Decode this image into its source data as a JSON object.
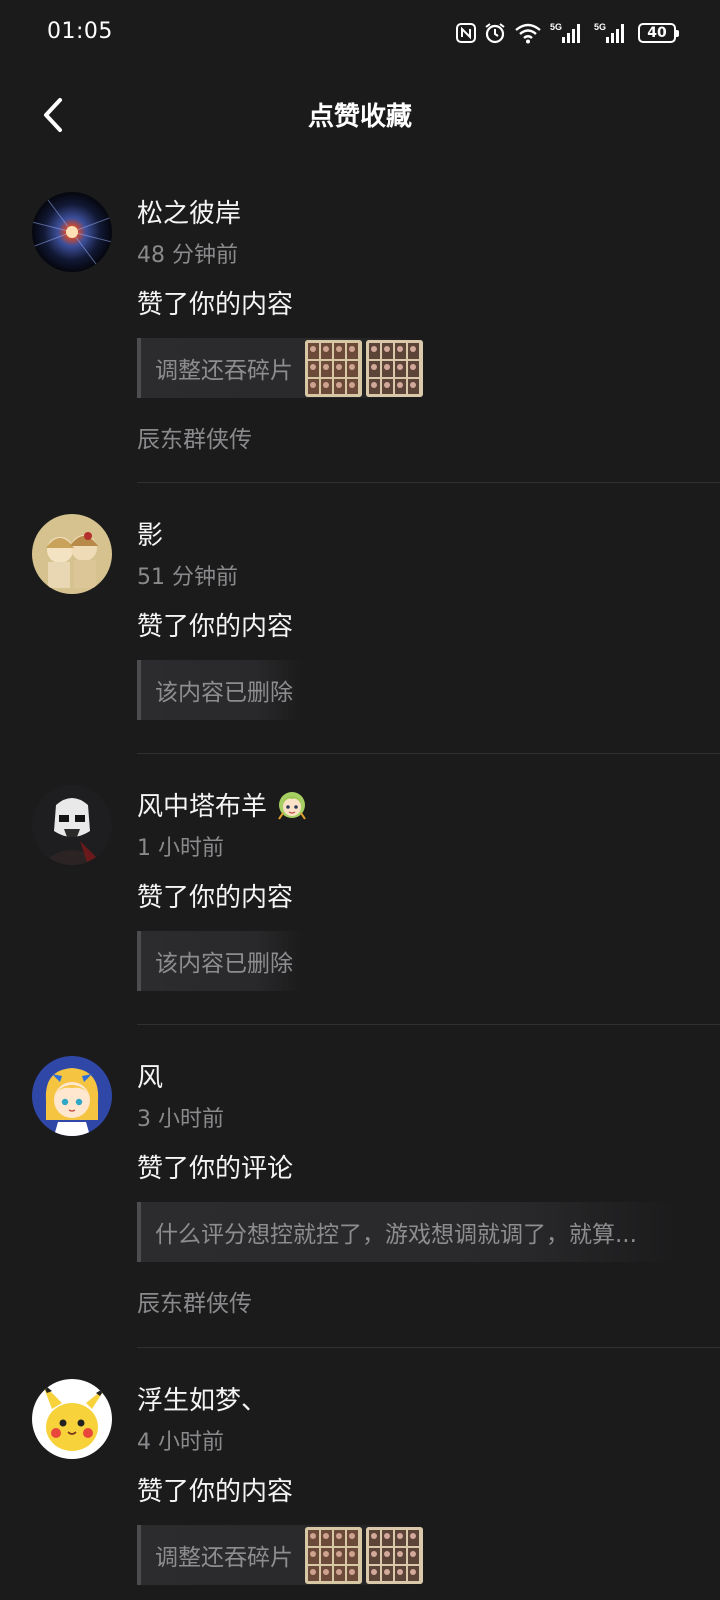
{
  "status_bar": {
    "time": "01:05",
    "battery": "40",
    "signal1_label": "5G",
    "signal2_label": "5G"
  },
  "header": {
    "title": "点赞收藏"
  },
  "notifications": [
    {
      "username": "松之彼岸",
      "time": "48 分钟前",
      "action": "赞了你的内容",
      "quote": "调整还吞碎片",
      "has_thumbs": true,
      "source": "辰东群侠传",
      "avatar_icon": "galaxy-avatar"
    },
    {
      "username": "影",
      "time": "51 分钟前",
      "action": "赞了你的内容",
      "quote": "该内容已删除",
      "has_thumbs": false,
      "source": "",
      "avatar_icon": "anime-girls-avatar"
    },
    {
      "username": "风中塔布羊",
      "time": "1 小时前",
      "action": "赞了你的内容",
      "quote": "该内容已删除",
      "has_thumbs": false,
      "source": "",
      "avatar_icon": "stormtrooper-avatar",
      "badge_icon": "anime-sticker-icon"
    },
    {
      "username": "风",
      "time": "3 小时前",
      "action": "赞了你的评论",
      "quote": "什么评分想控就控了，游戏想调就调了，就算...",
      "has_thumbs": false,
      "source": "辰东群侠传",
      "avatar_icon": "cartoon-girl-avatar"
    },
    {
      "username": "浮生如梦、",
      "time": "4 小时前",
      "action": "赞了你的内容",
      "quote": "调整还吞碎片",
      "has_thumbs": true,
      "source": "",
      "avatar_icon": "pikachu-avatar"
    }
  ],
  "colors": {
    "background": "#1b1b1c",
    "secondary_text": "#8a8a8c",
    "quote_bg": "#2c2c2f"
  }
}
